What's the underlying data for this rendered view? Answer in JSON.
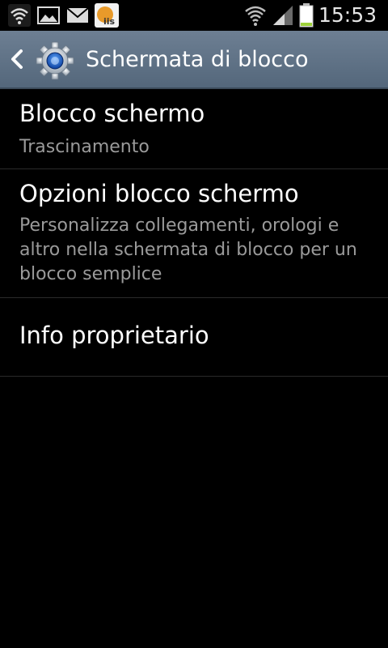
{
  "status_bar": {
    "time": "15:53",
    "icons": [
      "wifi-icon",
      "gallery-icon",
      "mail-icon",
      "iis-app-icon",
      "wifi-signal-icon",
      "cell-signal-icon",
      "battery-icon"
    ]
  },
  "action_bar": {
    "title": "Schermata di blocco",
    "back_icon": "chevron-left-icon",
    "app_icon": "settings-gear-icon"
  },
  "list": {
    "items": [
      {
        "title": "Blocco schermo",
        "summary": "Trascinamento"
      },
      {
        "title": "Opzioni blocco schermo",
        "summary": "Personalizza collegamenti, orologi e altro nella schermata di blocco per un blocco semplice"
      },
      {
        "title": "Info proprietario"
      }
    ]
  },
  "colors": {
    "action_bar_top": "#6d7f93",
    "action_bar_bottom": "#54677b",
    "summary_text": "#9a9a9a",
    "divider": "#2a2a2a",
    "battery_fill": "#9ed13a"
  }
}
